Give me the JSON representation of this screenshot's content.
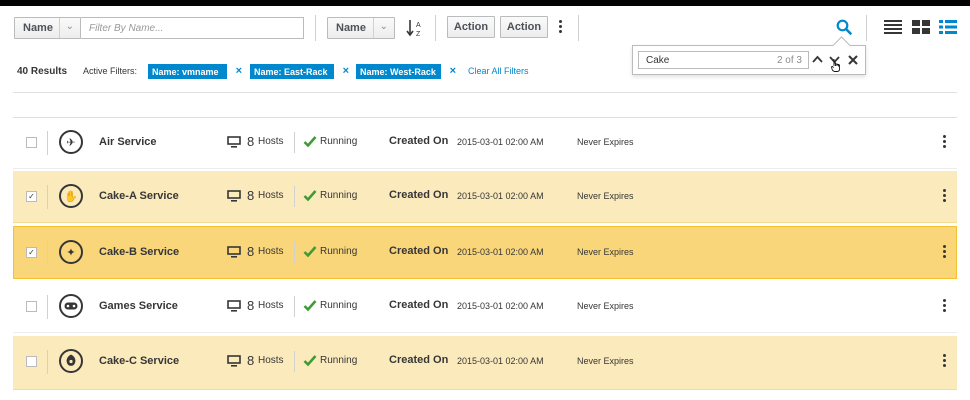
{
  "toolbar": {
    "filter_field_label": "Name",
    "filter_placeholder": "Filter By Name...",
    "sort_field_label": "Name",
    "action1_label": "Action",
    "action2_label": "Action",
    "sort_icon": "sort-alpha-asc-icon",
    "search_icon": "search-icon",
    "view_icons": [
      "list-view-icon",
      "card-view-icon",
      "table-view-icon"
    ],
    "active_view": "table-view"
  },
  "find": {
    "value": "Cake",
    "count": "2 of 3",
    "prev_icon": "chevron-up-icon",
    "next_icon": "chevron-down-icon",
    "close_icon": "close-icon"
  },
  "results": {
    "count_label": "40 Results",
    "active_filters_label": "Active Filters:",
    "filters": [
      "Name: vmname",
      "Name: East-Rack",
      "Name: West-Rack"
    ],
    "clear_all_label": "Clear All Filters"
  },
  "rows": [
    {
      "name": "Air Service",
      "icon": "plane-icon",
      "hosts_count": "8",
      "hosts_label": "Hosts",
      "status": "Running",
      "created_label": "Created On",
      "created_value": "2015-03-01 02:00 AM",
      "expires": "Never Expires",
      "checked": false,
      "highlight": "none"
    },
    {
      "name": "Cake-A Service",
      "icon": "hand-icon",
      "hosts_count": "8",
      "hosts_label": "Hosts",
      "status": "Running",
      "created_label": "Created On",
      "created_value": "2015-03-01 02:00 AM",
      "expires": "Never Expires",
      "checked": true,
      "highlight": "match"
    },
    {
      "name": "Cake-B Service",
      "icon": "magic-wand-icon",
      "hosts_count": "8",
      "hosts_label": "Hosts",
      "status": "Running",
      "created_label": "Created On",
      "created_value": "2015-03-01 02:00 AM",
      "expires": "Never Expires",
      "checked": true,
      "highlight": "current-match"
    },
    {
      "name": "Games Service",
      "icon": "gamepad-icon",
      "hosts_count": "8",
      "hosts_label": "Hosts",
      "status": "Running",
      "created_label": "Created On",
      "created_value": "2015-03-01 02:00 AM",
      "expires": "Never Expires",
      "checked": false,
      "highlight": "none"
    },
    {
      "name": "Cake-C Service",
      "icon": "rebel-icon",
      "hosts_count": "8",
      "hosts_label": "Hosts",
      "status": "Running",
      "created_label": "Created On",
      "created_value": "2015-03-01 02:00 AM",
      "expires": "Never Expires",
      "checked": false,
      "highlight": "match"
    }
  ],
  "colors": {
    "accent": "#0088ce",
    "match_bg": "#fbeabc",
    "current_match_bg": "#f9d67a",
    "running_check": "#3f9c35"
  }
}
